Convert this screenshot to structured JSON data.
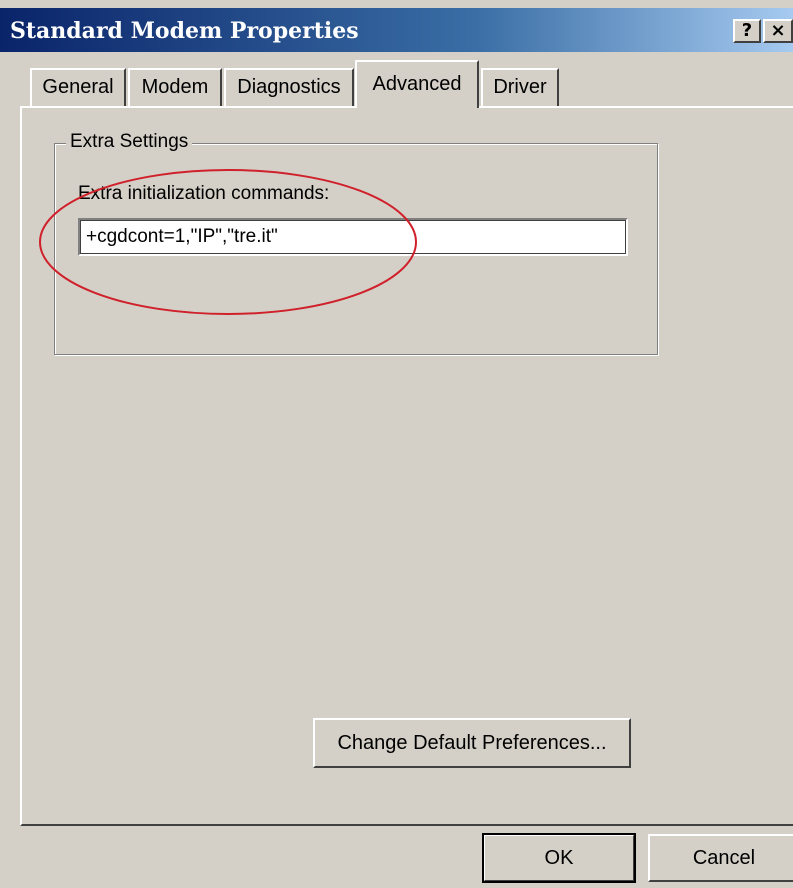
{
  "window": {
    "title": "Standard Modem Properties",
    "help_glyph": "?",
    "close_glyph": "×"
  },
  "tabs": [
    {
      "label": "General"
    },
    {
      "label": "Modem"
    },
    {
      "label": "Diagnostics"
    },
    {
      "label": "Advanced"
    },
    {
      "label": "Driver"
    }
  ],
  "selected_tab": "Advanced",
  "extra_settings": {
    "group_label": "Extra Settings",
    "init_label": "Extra initialization commands:",
    "init_value": "+cgdcont=1,\"IP\",\"tre.it\""
  },
  "buttons": {
    "change_defaults": "Change Default Preferences...",
    "ok": "OK",
    "cancel": "Cancel"
  },
  "colors": {
    "face": "#d4d0c8",
    "title_start": "#0a246a",
    "annotation": "#d0202a"
  }
}
